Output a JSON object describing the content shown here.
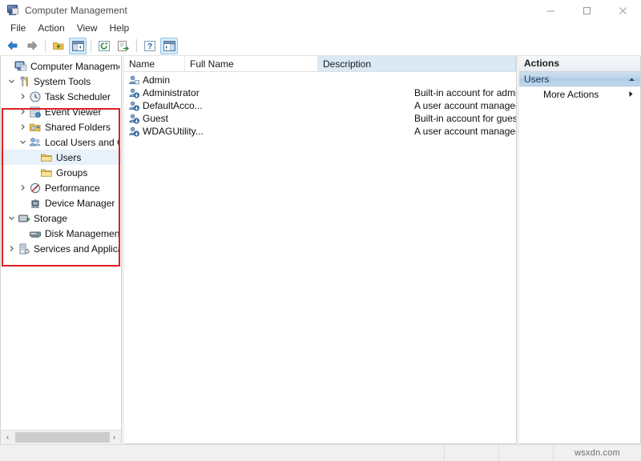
{
  "window": {
    "title": "Computer Management",
    "icon": "computer-management-icon",
    "controls": {
      "minimize": "minimize-icon",
      "maximize": "maximize-icon",
      "close": "close-icon"
    }
  },
  "menubar": {
    "items": [
      {
        "label": "File"
      },
      {
        "label": "Action"
      },
      {
        "label": "View"
      },
      {
        "label": "Help"
      }
    ]
  },
  "toolbar": {
    "buttons": [
      {
        "name": "back-button",
        "icon": "back-arrow-icon"
      },
      {
        "name": "forward-button",
        "icon": "forward-arrow-icon"
      },
      {
        "name": "up-one-level-button",
        "icon": "folder-up-icon"
      },
      {
        "name": "show-hide-console-tree-button",
        "icon": "console-tree-icon",
        "active": true
      },
      {
        "name": "refresh-button",
        "icon": "refresh-icon"
      },
      {
        "name": "export-list-button",
        "icon": "export-list-icon"
      },
      {
        "name": "help-button",
        "icon": "question-mark-icon"
      },
      {
        "name": "show-hide-action-pane-button",
        "icon": "action-pane-icon",
        "active": true
      }
    ]
  },
  "tree": {
    "nodes": [
      {
        "label": "Computer Management (Loca",
        "icon": "computer-management-icon",
        "indent": 0,
        "twisty": "none",
        "selected": false
      },
      {
        "label": "System Tools",
        "icon": "system-tools-icon",
        "indent": 1,
        "twisty": "expanded",
        "selected": false
      },
      {
        "label": "Task Scheduler",
        "icon": "clock-icon",
        "indent": 2,
        "twisty": "collapsed",
        "selected": false
      },
      {
        "label": "Event Viewer",
        "icon": "event-viewer-icon",
        "indent": 2,
        "twisty": "collapsed",
        "selected": false
      },
      {
        "label": "Shared Folders",
        "icon": "shared-folders-icon",
        "indent": 2,
        "twisty": "collapsed",
        "selected": false
      },
      {
        "label": "Local Users and Groups",
        "icon": "local-users-groups-icon",
        "indent": 2,
        "twisty": "expanded",
        "selected": false
      },
      {
        "label": "Users",
        "icon": "folder-icon",
        "indent": 3,
        "twisty": "none",
        "selected": true
      },
      {
        "label": "Groups",
        "icon": "folder-icon",
        "indent": 3,
        "twisty": "none",
        "selected": false
      },
      {
        "label": "Performance",
        "icon": "performance-icon",
        "indent": 2,
        "twisty": "collapsed",
        "selected": false
      },
      {
        "label": "Device Manager",
        "icon": "device-manager-icon",
        "indent": 2,
        "twisty": "none",
        "selected": false
      },
      {
        "label": "Storage",
        "icon": "storage-icon",
        "indent": 1,
        "twisty": "expanded",
        "selected": false
      },
      {
        "label": "Disk Management",
        "icon": "disk-management-icon",
        "indent": 2,
        "twisty": "none",
        "selected": false
      },
      {
        "label": "Services and Applications",
        "icon": "services-applications-icon",
        "indent": 1,
        "twisty": "collapsed",
        "selected": false
      }
    ],
    "hscroll": {
      "left_arrow": "‹",
      "right_arrow": "›"
    }
  },
  "list": {
    "columns": [
      {
        "label": "Name",
        "highlighted": false
      },
      {
        "label": "Full Name",
        "highlighted": false
      },
      {
        "label": "Description",
        "highlighted": true
      }
    ],
    "rows": [
      {
        "name": "Admin",
        "full_name": "",
        "description": "",
        "icon": "user-icon"
      },
      {
        "name": "Administrator",
        "full_name": "",
        "description": "Built-in account for administering...",
        "icon": "user-disabled-icon"
      },
      {
        "name": "DefaultAcco...",
        "full_name": "",
        "description": "A user account managed by the s...",
        "icon": "user-disabled-icon"
      },
      {
        "name": "Guest",
        "full_name": "",
        "description": "Built-in account for guest access t...",
        "icon": "user-disabled-icon"
      },
      {
        "name": "WDAGUtility...",
        "full_name": "",
        "description": "A user account managed and use...",
        "icon": "user-disabled-icon"
      }
    ]
  },
  "actions": {
    "title": "Actions",
    "sections": [
      {
        "label": "Users",
        "collapse_icon": "chevron-up-icon",
        "items": [
          {
            "label": "More Actions",
            "submenu_icon": "chevron-right-icon"
          }
        ]
      }
    ]
  },
  "statusbar": {
    "watermark": "wsxdn.com"
  },
  "annotation": {
    "color": "#e02020"
  }
}
